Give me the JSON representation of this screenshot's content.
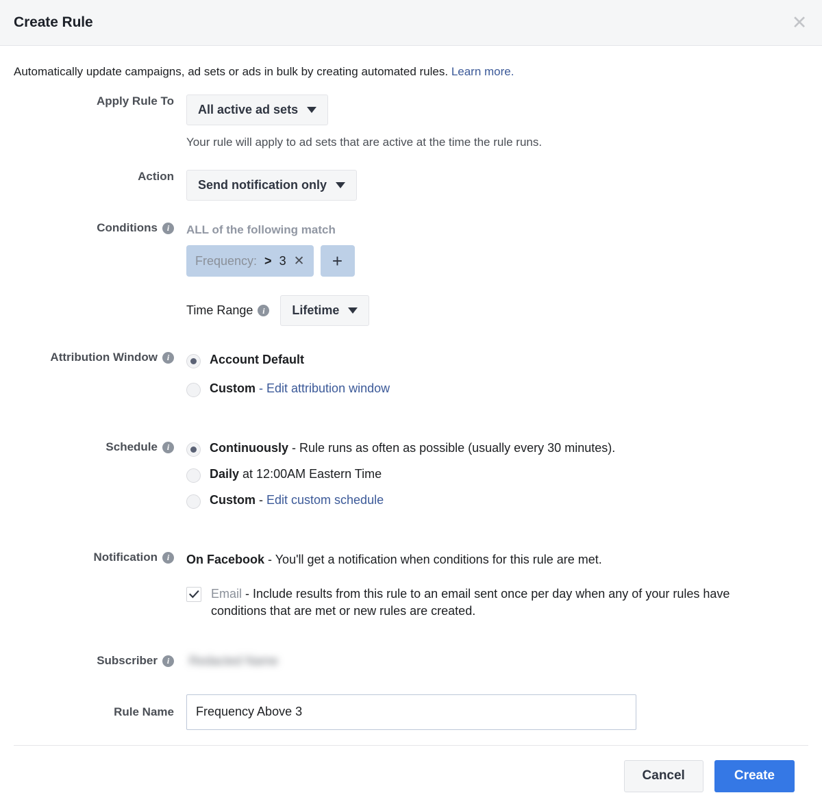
{
  "dialog": {
    "title": "Create Rule",
    "close_icon": "close-icon",
    "intro_text": "Automatically update campaigns, ad sets or ads in bulk by creating automated rules.",
    "intro_link": "Learn more."
  },
  "apply_rule_to": {
    "label": "Apply Rule To",
    "value": "All active ad sets",
    "helper": "Your rule will apply to ad sets that are active at the time the rule runs."
  },
  "action": {
    "label": "Action",
    "value": "Send notification only"
  },
  "conditions": {
    "label": "Conditions",
    "info_icon": "info-icon",
    "match_text": "ALL of the following match",
    "chips": [
      {
        "metric": "Frequency:",
        "operator": ">",
        "value": "3",
        "remove_icon": "close-icon"
      }
    ],
    "add_label": "+",
    "time_range": {
      "label": "Time Range",
      "value": "Lifetime"
    }
  },
  "attribution_window": {
    "label": "Attribution Window",
    "options": [
      {
        "label": "Account Default",
        "selected": true,
        "link": ""
      },
      {
        "label": "Custom",
        "selected": false,
        "link": "- Edit attribution window"
      }
    ]
  },
  "schedule": {
    "label": "Schedule",
    "options": [
      {
        "label": "Continuously",
        "detail": " - Rule runs as often as possible (usually every 30 minutes).",
        "selected": true,
        "link": ""
      },
      {
        "label": "Daily",
        "detail": " at 12:00AM Eastern Time",
        "selected": false,
        "link": ""
      },
      {
        "label": "Custom",
        "detail": " - ",
        "selected": false,
        "link": "Edit custom schedule"
      }
    ]
  },
  "notification": {
    "label": "Notification",
    "facebook_label": "On Facebook",
    "facebook_detail": " - You'll get a notification when conditions for this rule are met.",
    "email_checked": true,
    "email_label": "Email",
    "email_detail": " - Include results from this rule to an email sent once per day when any of your rules have conditions that are met or new rules are created."
  },
  "subscriber": {
    "label": "Subscriber",
    "value": "Redacted Name"
  },
  "rule_name": {
    "label": "Rule Name",
    "value": "Frequency Above 3",
    "placeholder": ""
  },
  "footer": {
    "cancel_label": "Cancel",
    "create_label": "Create"
  },
  "colors": {
    "accent": "#3578e5",
    "link": "#3b5998",
    "chip_bg": "#bdd0e7",
    "header_bg": "#f5f6f7"
  }
}
